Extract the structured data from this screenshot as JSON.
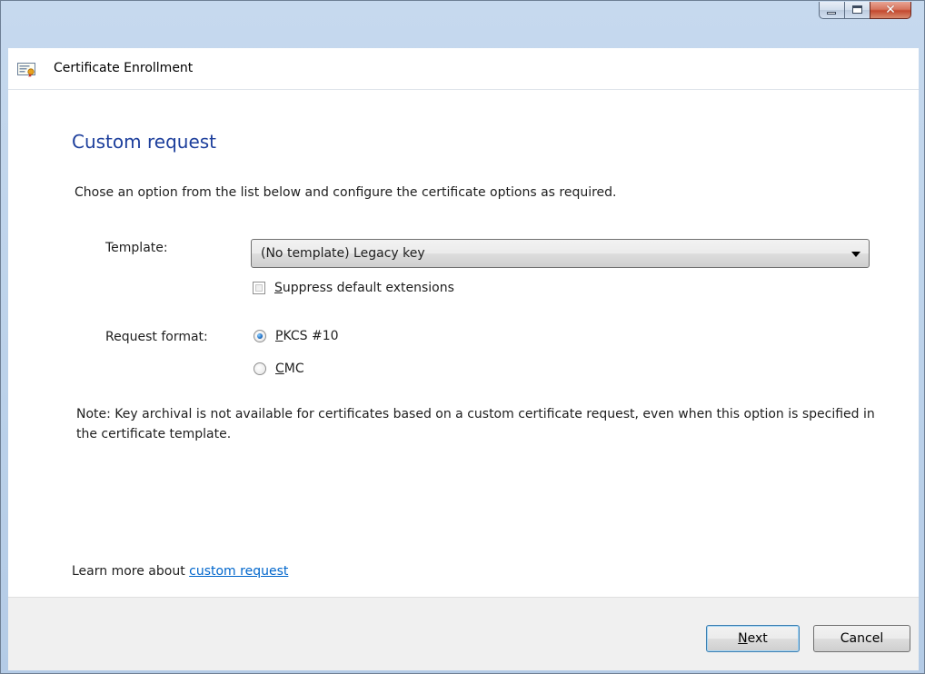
{
  "window": {
    "title": "Certificate Enrollment",
    "controls": {
      "minimize": "minimize",
      "maximize": "maximize",
      "close": "✕"
    }
  },
  "page": {
    "title": "Custom request",
    "instruction": "Chose an option from the list below and configure the certificate options as required."
  },
  "template": {
    "label": "Template:",
    "selected": "(No template) Legacy key",
    "suppress_mnemonic": "S",
    "suppress_rest": "uppress default extensions",
    "suppress_checked": false
  },
  "request_format": {
    "label": "Request format:",
    "options": [
      {
        "mnemonic": "P",
        "rest": "KCS #10",
        "checked": true
      },
      {
        "mnemonic": "C",
        "rest": "MC",
        "checked": false
      }
    ]
  },
  "note": "Note: Key archival is not available for certificates based on a custom certificate request, even when this option is specified in the certificate template.",
  "learn_more": {
    "prefix": "Learn more about ",
    "link": "custom request"
  },
  "buttons": {
    "next_mnemonic": "N",
    "next_rest": "ext",
    "cancel": "Cancel"
  },
  "icons": {
    "app": "certificate-icon",
    "dropdown": "chevron-down-icon"
  },
  "colors": {
    "title_blue": "#1d3f9c",
    "link_blue": "#0066cc",
    "footer_bg": "#f0f0f0"
  }
}
